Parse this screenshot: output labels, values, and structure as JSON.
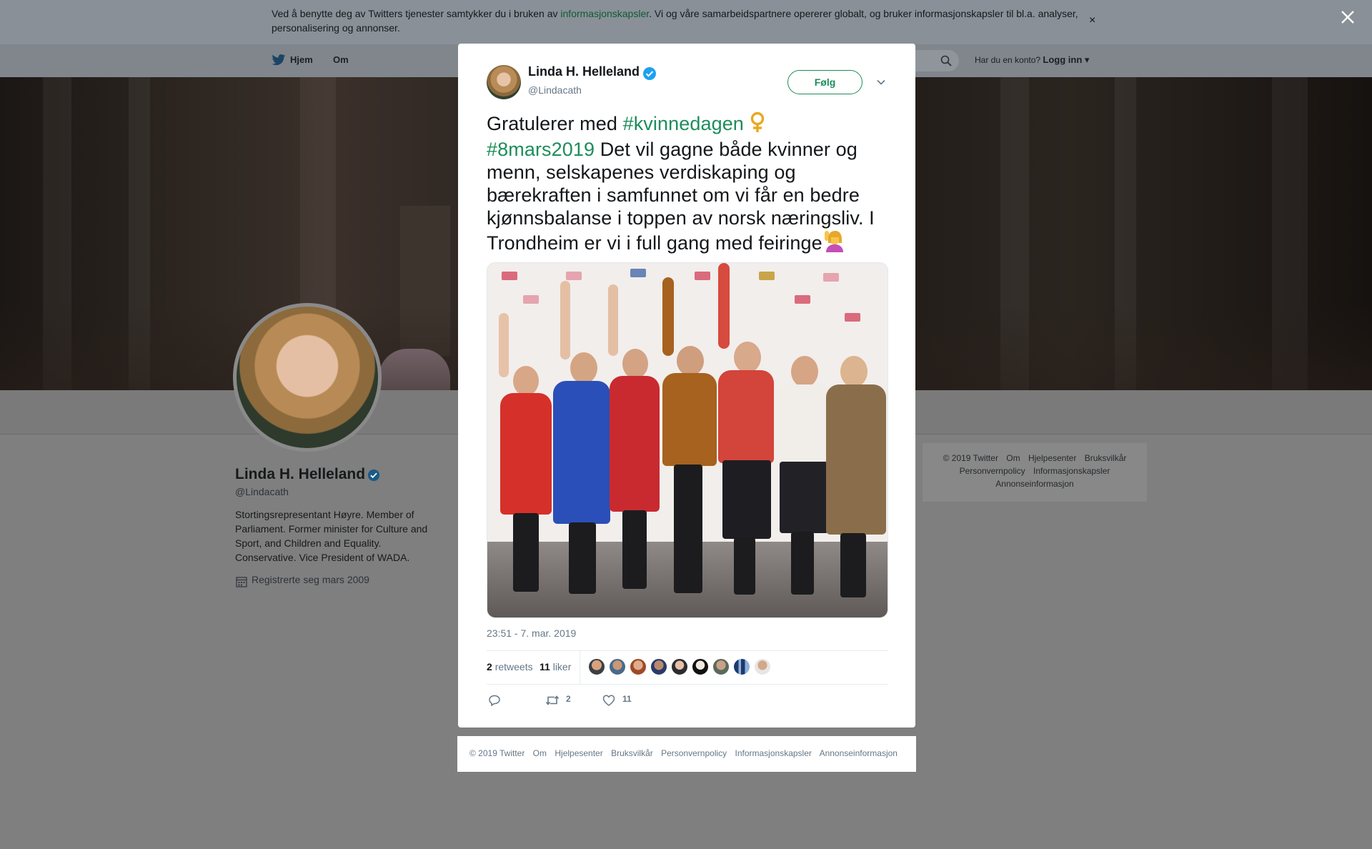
{
  "cookie_banner": {
    "text_before": "Ved å benytte deg av Twitters tjenester samtykker du i bruken av ",
    "link": "informasjonskapsler",
    "text_after": ". Vi og våre samarbeidspartnere opererer globalt, og bruker informasjonskapsler til bl.a. analyser, personalisering og annonser.",
    "close_label": "×"
  },
  "topnav": {
    "home": "Hjem",
    "about": "Om",
    "account_prompt": "Har du en konto?",
    "login": "Logg inn"
  },
  "profile": {
    "name": "Linda H. Helleland",
    "handle": "@Lindacath",
    "bio": "Stortingsrepresentant Høyre. Member of Parliament. Former minister for Culture and Sport, and Children and Equality. Conservative. Vice President of WADA.",
    "joined": "Registrerte seg mars 2009"
  },
  "side_footer": {
    "line1": [
      "© 2019 Twitter",
      "Om",
      "Hjelpesenter",
      "Bruksvilkår"
    ],
    "line2": [
      "Personvernpolicy",
      "Informasjonskapsler"
    ],
    "line3": [
      "Annonseinformasjon"
    ]
  },
  "tweet": {
    "author_name": "Linda H. Helleland",
    "author_handle": "@Lindacath",
    "follow_label": "Følg",
    "text_parts": {
      "p1": "Gratulerer med ",
      "hashtag1": "#kvinnedagen",
      "emoji1": "♀️",
      "hashtag2": "#8mars2019",
      "p2": " Det vil gagne både kvinner og menn, selskapenes verdiskaping og bærekraften i samfunnet om vi får en bedre kjønnsbalanse i toppen av norsk næringsliv. I Trondheim er vi i full gang med feiringe",
      "emoji2": "🙋‍♀️"
    },
    "timestamp": "23:51 - 7. mar. 2019",
    "retweets_count": "2",
    "retweets_label": "retweets",
    "likes_count": "11",
    "likes_label": "liker",
    "action_retweet_count": "2",
    "action_like_count": "11"
  },
  "modal_footer": [
    "© 2019 Twitter",
    "Om",
    "Hjelpesenter",
    "Bruksvilkår",
    "Personvernpolicy",
    "Informasjonskapsler",
    "Annonseinformasjon"
  ],
  "colors": {
    "accent": "#1d8d5b",
    "verified": "#1da1f2",
    "muted": "#657786"
  }
}
